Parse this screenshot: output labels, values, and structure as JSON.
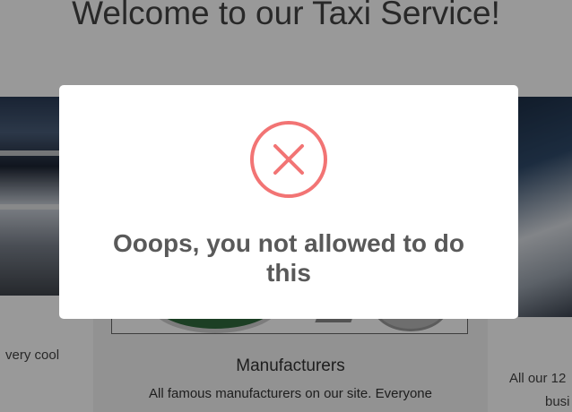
{
  "page": {
    "title": "Welcome to our Taxi Service!"
  },
  "cards": {
    "left": {
      "text": "very cool"
    },
    "center": {
      "title": "Manufacturers",
      "text": "All famous manufacturers on our site. Everyone"
    },
    "right": {
      "text_line1": "All our 12",
      "text_line2": "busi"
    }
  },
  "modal": {
    "icon": "error-x-icon",
    "title": "Ooops, you not allowed to do this",
    "icon_color": "#f27474"
  }
}
